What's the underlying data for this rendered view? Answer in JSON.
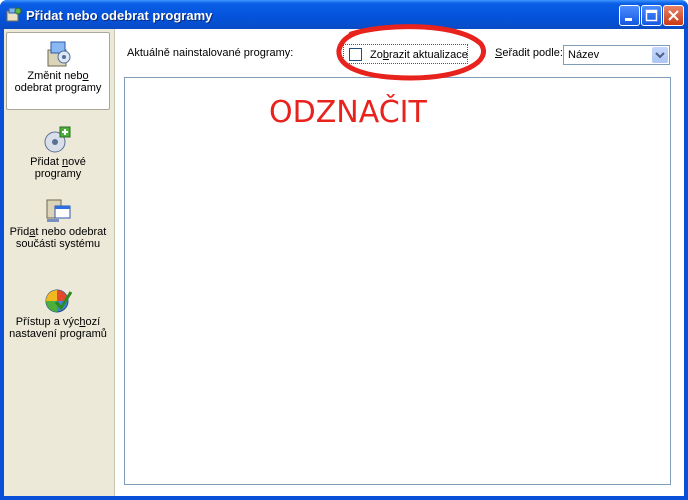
{
  "window": {
    "title": "Přidat nebo odebrat programy",
    "app_icon": "add-remove-programs-icon"
  },
  "sidebar": {
    "items": [
      {
        "label_pre": "Změnit neb",
        "label_u": "o",
        "label_post": " odebrat programy",
        "icon": "change-remove-programs-icon",
        "active": true
      },
      {
        "label_pre": "Přidat ",
        "label_u": "n",
        "label_post": "ové programy",
        "icon": "add-new-programs-icon",
        "active": false
      },
      {
        "label_pre": "Přid",
        "label_u": "a",
        "label_post": "t nebo odebrat součásti systému",
        "icon": "windows-components-icon",
        "active": false
      },
      {
        "label_pre": "Přístup a výc",
        "label_u": "h",
        "label_post": "ozí nastavení programů",
        "icon": "program-access-defaults-icon",
        "active": false
      }
    ]
  },
  "main": {
    "installed_label": "Aktuálně nainstalované programy:",
    "show_updates": {
      "pre": "Zo",
      "u": "b",
      "post": "razit aktualizace",
      "checked": false
    },
    "sort": {
      "label_u": "S",
      "label_post": "eřadit podle:",
      "value": "Název"
    }
  },
  "annotation": {
    "text": "ODZNAČIT",
    "color": "#e8221c"
  },
  "colors": {
    "titlebar": "#0555df",
    "sidebar": "#ece9d8",
    "border": "#7f9db9"
  }
}
